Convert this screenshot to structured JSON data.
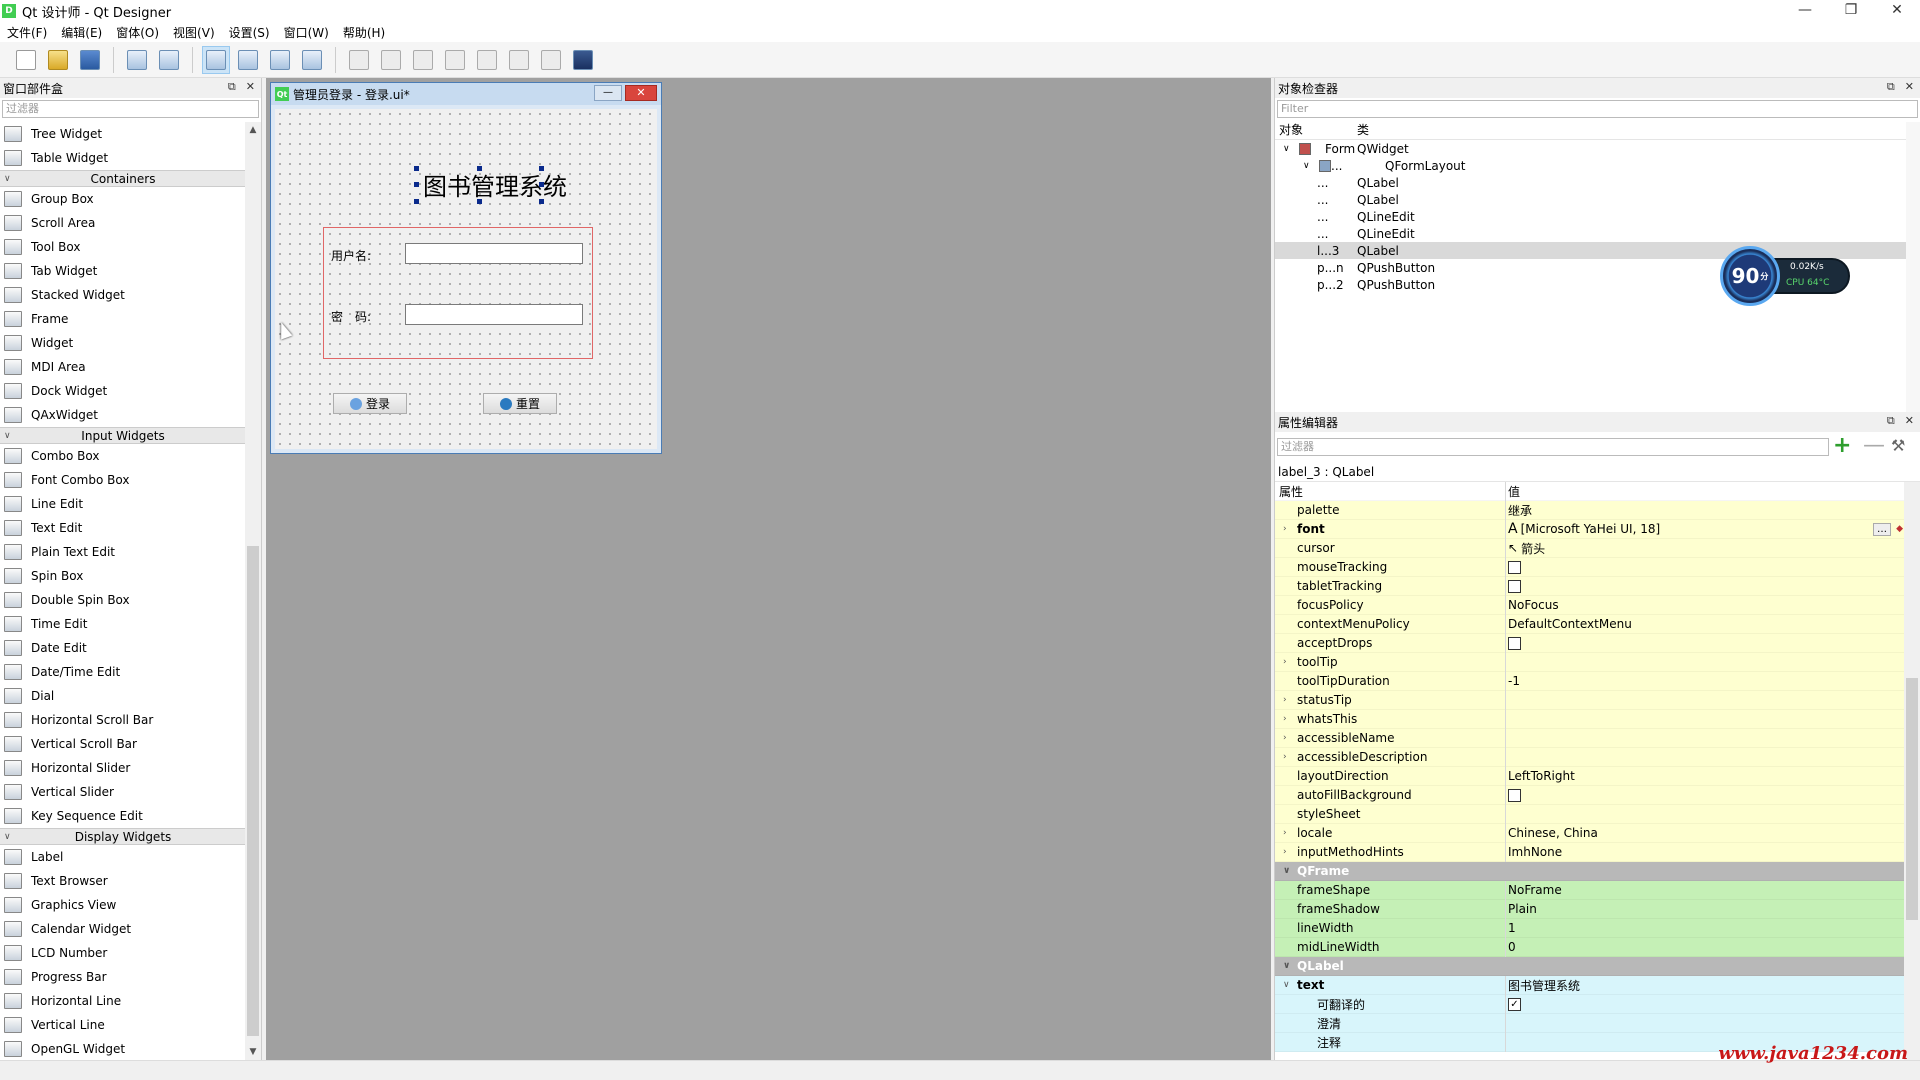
{
  "window": {
    "title": "Qt 设计师 - Qt Designer",
    "app_icon": "D",
    "minimize": "—",
    "maximize": "❐",
    "close": "✕"
  },
  "menu": [
    "文件(F)",
    "编辑(E)",
    "窗体(O)",
    "视图(V)",
    "设置(S)",
    "窗口(W)",
    "帮助(H)"
  ],
  "widget_box": {
    "title": "窗口部件盒",
    "filter_placeholder": "过滤器",
    "items": [
      {
        "label": "Tree Widget"
      },
      {
        "label": "Table Widget"
      },
      {
        "category": "Containers"
      },
      {
        "label": "Group Box"
      },
      {
        "label": "Scroll Area"
      },
      {
        "label": "Tool Box"
      },
      {
        "label": "Tab Widget"
      },
      {
        "label": "Stacked Widget"
      },
      {
        "label": "Frame"
      },
      {
        "label": "Widget"
      },
      {
        "label": "MDI Area"
      },
      {
        "label": "Dock Widget"
      },
      {
        "label": "QAxWidget"
      },
      {
        "category": "Input Widgets"
      },
      {
        "label": "Combo Box"
      },
      {
        "label": "Font Combo Box"
      },
      {
        "label": "Line Edit"
      },
      {
        "label": "Text Edit"
      },
      {
        "label": "Plain Text Edit"
      },
      {
        "label": "Spin Box"
      },
      {
        "label": "Double Spin Box"
      },
      {
        "label": "Time Edit"
      },
      {
        "label": "Date Edit"
      },
      {
        "label": "Date/Time Edit"
      },
      {
        "label": "Dial"
      },
      {
        "label": "Horizontal Scroll Bar"
      },
      {
        "label": "Vertical Scroll Bar"
      },
      {
        "label": "Horizontal Slider"
      },
      {
        "label": "Vertical Slider"
      },
      {
        "label": "Key Sequence Edit"
      },
      {
        "category": "Display Widgets"
      },
      {
        "label": "Label"
      },
      {
        "label": "Text Browser"
      },
      {
        "label": "Graphics View"
      },
      {
        "label": "Calendar Widget"
      },
      {
        "label": "LCD Number"
      },
      {
        "label": "Progress Bar"
      },
      {
        "label": "Horizontal Line"
      },
      {
        "label": "Vertical Line"
      },
      {
        "label": "OpenGL Widget"
      }
    ]
  },
  "form": {
    "window_title": "管理员登录 - 登录.ui*",
    "qt_icon": "Qt",
    "heading": "图书管理系统",
    "username_label": "用户名:",
    "password_label": "密　码:",
    "login_button": "登录",
    "reset_button": "重置"
  },
  "object_inspector": {
    "title": "对象检查器",
    "filter_placeholder": "Filter",
    "col_object": "对象",
    "col_class": "类",
    "rows": [
      {
        "object": "Form",
        "class": "QWidget",
        "level": 0,
        "expanded": true
      },
      {
        "object": "...",
        "class": "QFormLayout",
        "level": 1,
        "expanded": true
      },
      {
        "object": "...",
        "class": "QLabel",
        "level": 2
      },
      {
        "object": "...",
        "class": "QLabel",
        "level": 2
      },
      {
        "object": "...",
        "class": "QLineEdit",
        "level": 2
      },
      {
        "object": "...",
        "class": "QLineEdit",
        "level": 2
      },
      {
        "object": "l...3",
        "class": "QLabel",
        "level": 1,
        "selected": true
      },
      {
        "object": "p...n",
        "class": "QPushButton",
        "level": 1
      },
      {
        "object": "p...2",
        "class": "QPushButton",
        "level": 1
      }
    ]
  },
  "net_monitor": {
    "percent": "90",
    "unit": "分",
    "speed": "0.02K/s",
    "cpu": "CPU 64°C"
  },
  "property_editor": {
    "title": "属性编辑器",
    "filter_placeholder": "过滤器",
    "object_line": "label_3 : QLabel",
    "col_property": "属性",
    "col_value": "值",
    "rows": [
      {
        "name": "palette",
        "value": "继承",
        "style": "yellow"
      },
      {
        "name": "font",
        "value": "[Microsoft YaHei UI, 18]",
        "style": "yellow",
        "bold": true,
        "expander": true,
        "icon": "font-icon"
      },
      {
        "name": "cursor",
        "value": "箭头",
        "style": "yellow",
        "icon": "arrow-cursor-icon"
      },
      {
        "name": "mouseTracking",
        "checkbox": false,
        "style": "yellow"
      },
      {
        "name": "tabletTracking",
        "checkbox": false,
        "style": "yellow"
      },
      {
        "name": "focusPolicy",
        "value": "NoFocus",
        "style": "yellow"
      },
      {
        "name": "contextMenuPolicy",
        "value": "DefaultContextMenu",
        "style": "yellow"
      },
      {
        "name": "acceptDrops",
        "checkbox": false,
        "style": "yellow"
      },
      {
        "name": "toolTip",
        "value": "",
        "style": "yellow",
        "expander": true
      },
      {
        "name": "toolTipDuration",
        "value": "-1",
        "style": "yellow"
      },
      {
        "name": "statusTip",
        "value": "",
        "style": "yellow",
        "expander": true
      },
      {
        "name": "whatsThis",
        "value": "",
        "style": "yellow",
        "expander": true
      },
      {
        "name": "accessibleName",
        "value": "",
        "style": "yellow",
        "expander": true
      },
      {
        "name": "accessibleDescription",
        "value": "",
        "style": "yellow",
        "expander": true
      },
      {
        "name": "layoutDirection",
        "value": "LeftToRight",
        "style": "yellow"
      },
      {
        "name": "autoFillBackground",
        "checkbox": false,
        "style": "yellow"
      },
      {
        "name": "styleSheet",
        "value": "",
        "style": "yellow"
      },
      {
        "name": "locale",
        "value": "Chinese, China",
        "style": "yellow",
        "expander": true
      },
      {
        "name": "inputMethodHints",
        "value": "ImhNone",
        "style": "yellow",
        "expander": true
      },
      {
        "name": "QFrame",
        "style": "group"
      },
      {
        "name": "frameShape",
        "value": "NoFrame",
        "style": "green"
      },
      {
        "name": "frameShadow",
        "value": "Plain",
        "style": "green"
      },
      {
        "name": "lineWidth",
        "value": "1",
        "style": "green"
      },
      {
        "name": "midLineWidth",
        "value": "0",
        "style": "green"
      },
      {
        "name": "QLabel",
        "style": "group"
      },
      {
        "name": "text",
        "value": "图书管理系统",
        "style": "cyan",
        "bold": true,
        "expander": true,
        "expanded": true
      },
      {
        "name": "可翻译的",
        "checkbox": true,
        "style": "cyan",
        "sub": true
      },
      {
        "name": "澄清",
        "value": "",
        "style": "cyan",
        "sub": true
      },
      {
        "name": "注释",
        "value": "",
        "style": "cyan",
        "sub": true
      }
    ]
  },
  "watermark": "www.java1234.com"
}
